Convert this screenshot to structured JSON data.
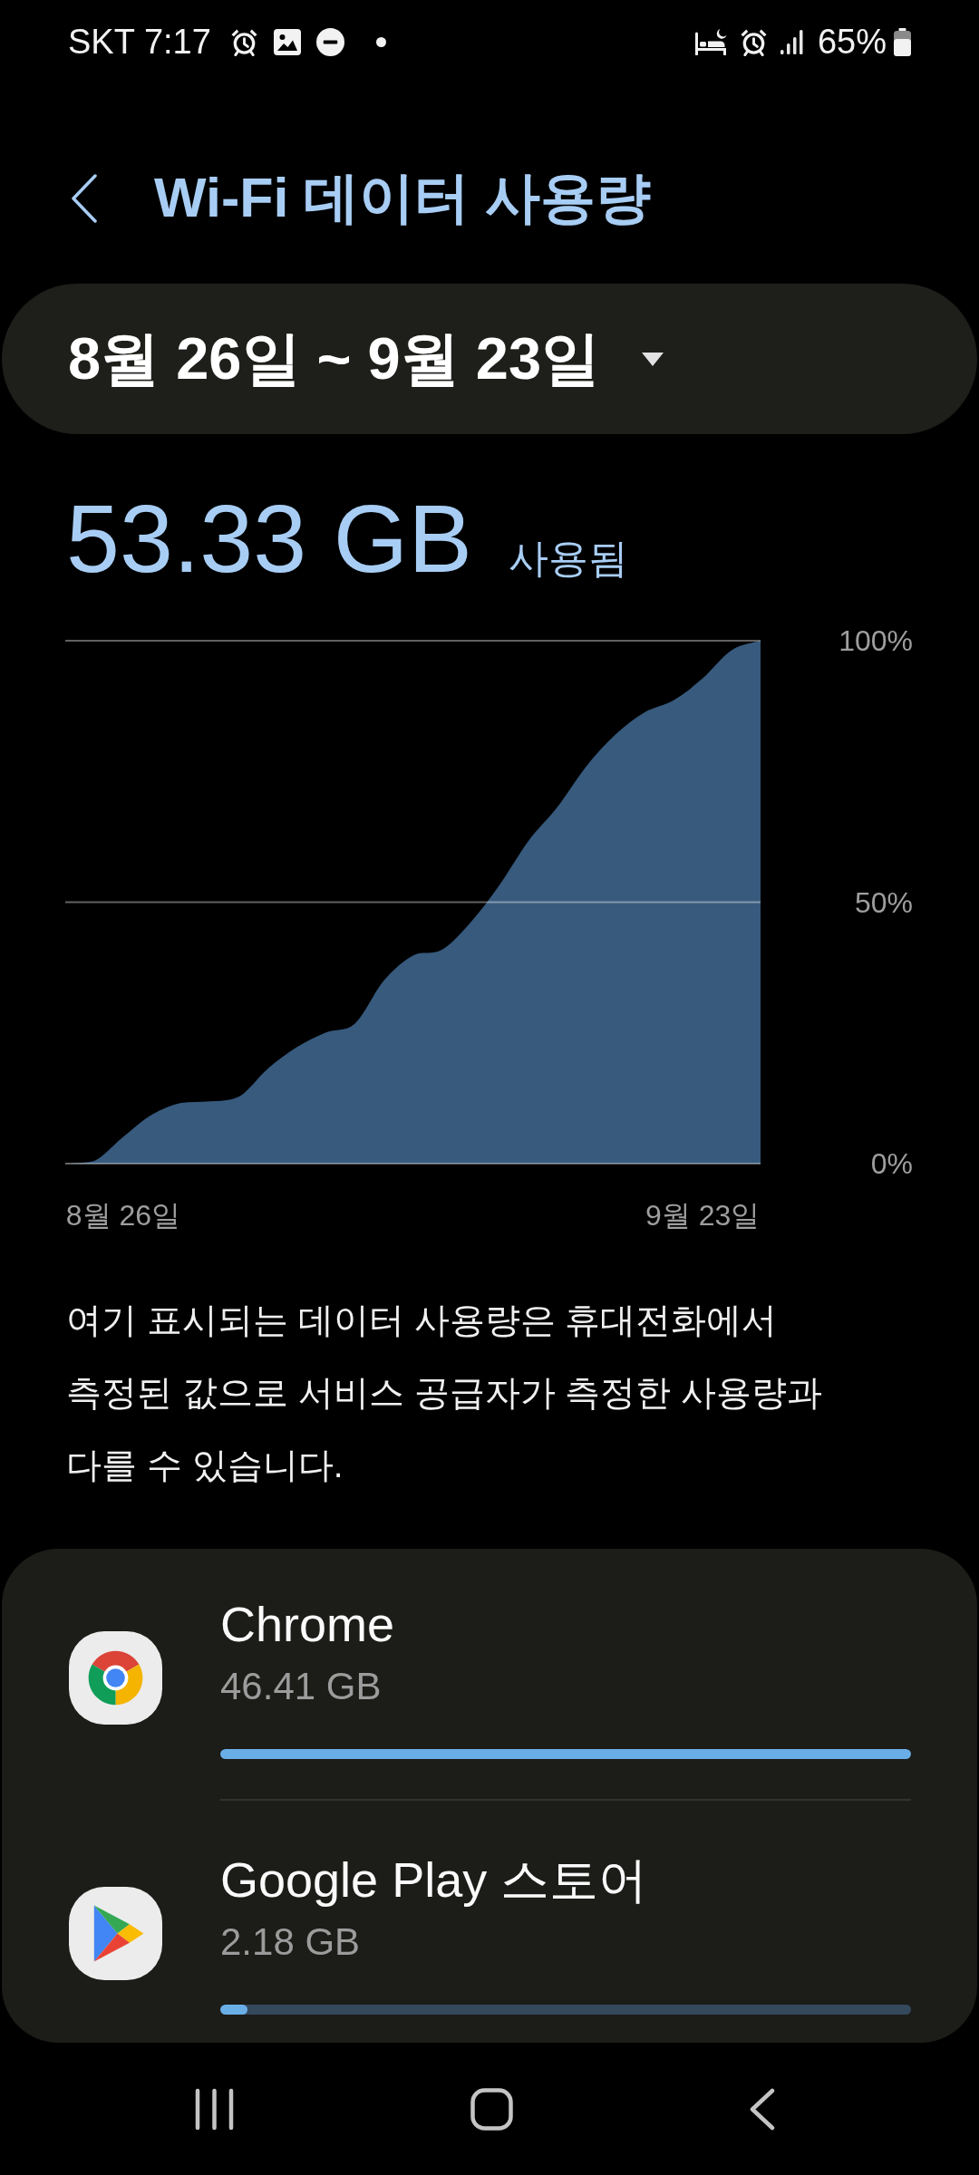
{
  "status_bar": {
    "carrier": "SKT",
    "time": "7:17",
    "battery": "65%"
  },
  "header": {
    "title": "Wi-Fi 데이터 사용량"
  },
  "date_range": {
    "label": "8월 26일 ~ 9월 23일"
  },
  "total": {
    "amount": "53.33 GB",
    "caption": "사용됨"
  },
  "usage_chart": {
    "chart_data": {
      "type": "area",
      "categories": [
        null,
        null,
        "8월 26일",
        null,
        null,
        null,
        null,
        null,
        null,
        null,
        null,
        null,
        null,
        null,
        null,
        null,
        null,
        null,
        null,
        null,
        null,
        null,
        "9월 23일",
        null,
        null
      ],
      "series": [
        {
          "color": "#375a7d",
          "values": [
            0,
            0.5,
            5.1,
            9.4,
            11.6,
            11.9,
            12.8,
            18.2,
            22.3,
            25.1,
            26.8,
            35,
            39.8,
            40.9,
            46.2,
            53.4,
            61.8,
            68.3,
            76.1,
            82.1,
            86.3,
            88.6,
            92.8,
            98.2,
            100
          ]
        }
      ],
      "ylim": [
        0,
        100
      ],
      "yticks": [
        {
          "value": 0,
          "label": "0%"
        },
        {
          "value": 50,
          "label": "50%"
        },
        {
          "value": 100,
          "label": "100%"
        }
      ]
    }
  },
  "note": "여기 표시되는 데이터 사용량은 휴대전화에서 측정된 값으로 서비스 공급자가 측정한 사용량과 다를 수 있습니다.",
  "apps": [
    {
      "kind": "browser",
      "name": "Chrome",
      "usage": "46.41 GB",
      "level": 1
    },
    {
      "kind": "store",
      "name": "Google Play 스토어",
      "usage": "2.18 GB",
      "level": 0.04
    }
  ]
}
